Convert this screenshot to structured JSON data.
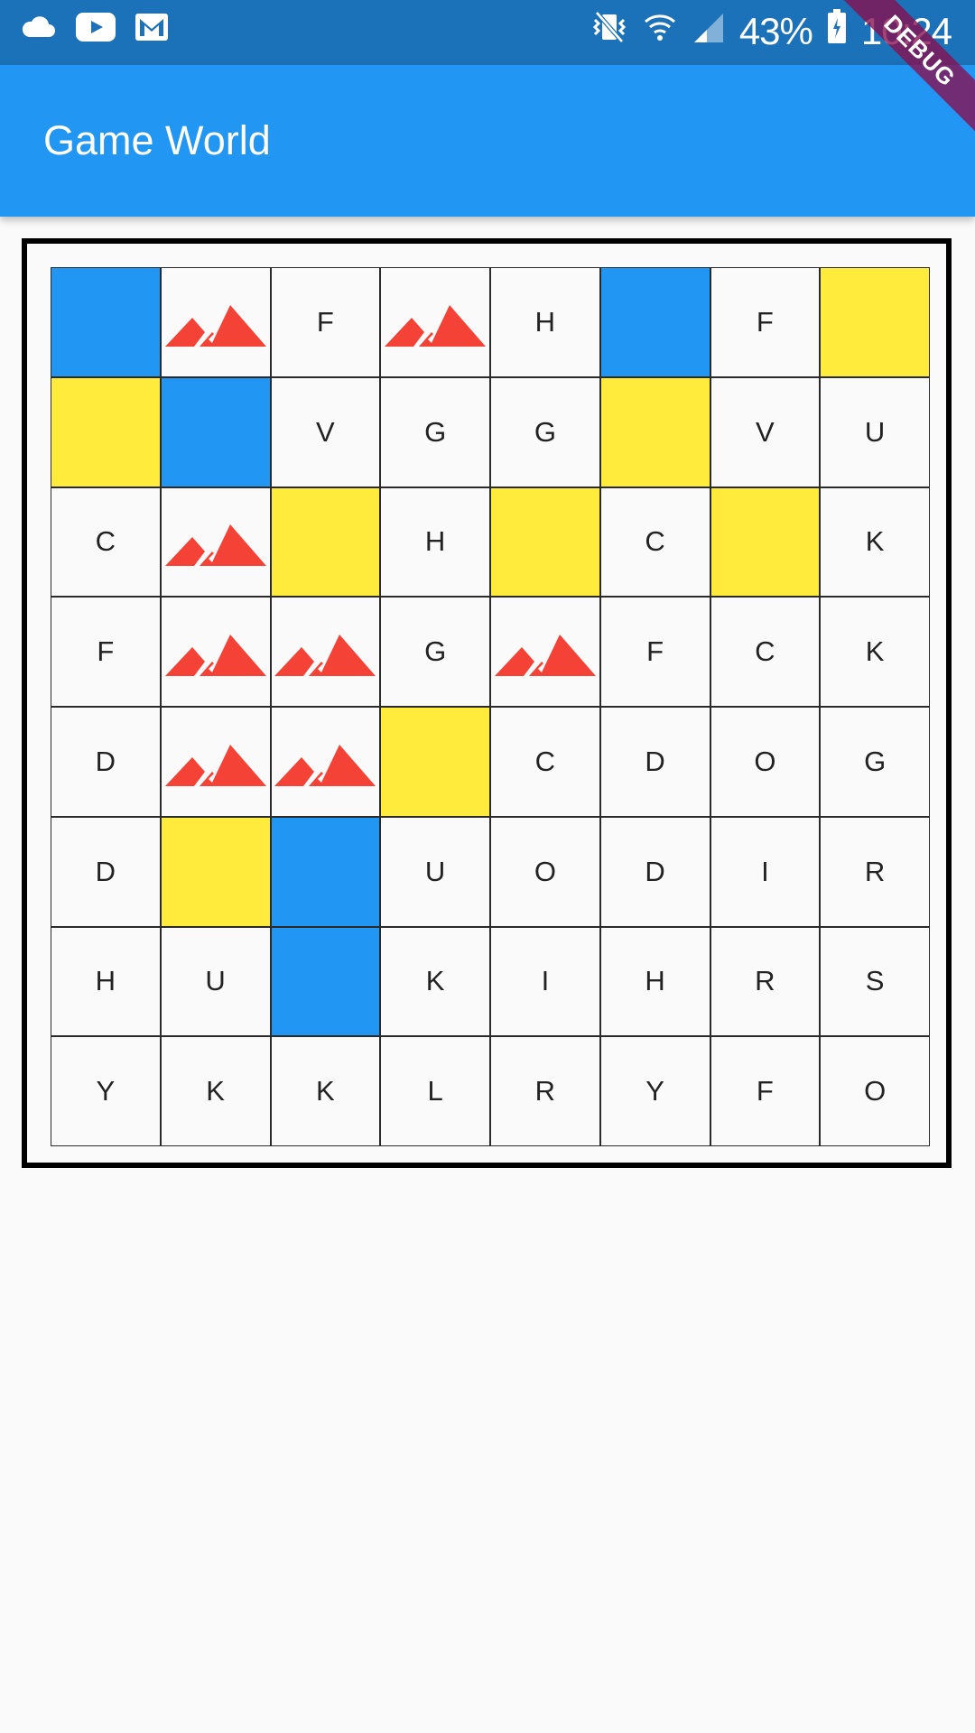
{
  "status_bar": {
    "left_icons": [
      "cloud-icon",
      "youtube-icon",
      "gmail-icon"
    ],
    "right_icons": [
      "vibrate-icon",
      "wifi-icon",
      "signal-icon",
      "battery-icon"
    ],
    "battery": "43%",
    "time": "10:24"
  },
  "app_bar": {
    "title": "Game World",
    "debug_banner": "DEBUG"
  },
  "colors": {
    "status_bar": "#1b72b8",
    "app_bar": "#2196f3",
    "water": "#2196f3",
    "sand": "#ffeb3b",
    "mountain": "#f44336",
    "plain": "#fafafa"
  },
  "legend_types": {
    "W": "water",
    "S": "sand",
    "M": "mountain-icon"
  },
  "grid": [
    [
      "W",
      "M",
      "F",
      "M",
      "H",
      "W",
      "F",
      "S"
    ],
    [
      "S",
      "W",
      "V",
      "G",
      "G",
      "S",
      "V",
      "U"
    ],
    [
      "C",
      "M",
      "S",
      "H",
      "S",
      "C",
      "S",
      "K"
    ],
    [
      "F",
      "M",
      "M",
      "G",
      "M",
      "F",
      "C",
      "K"
    ],
    [
      "D",
      "M",
      "M",
      "S",
      "C",
      "D",
      "O",
      "G"
    ],
    [
      "D",
      "S",
      "W",
      "U",
      "O",
      "D",
      "I",
      "R"
    ],
    [
      "H",
      "U",
      "W",
      "K",
      "I",
      "H",
      "R",
      "S_LETTER"
    ],
    [
      "Y",
      "K",
      "K",
      "L",
      "R",
      "Y",
      "F",
      "O"
    ]
  ],
  "letter_overrides": {
    "S_LETTER": "S"
  }
}
